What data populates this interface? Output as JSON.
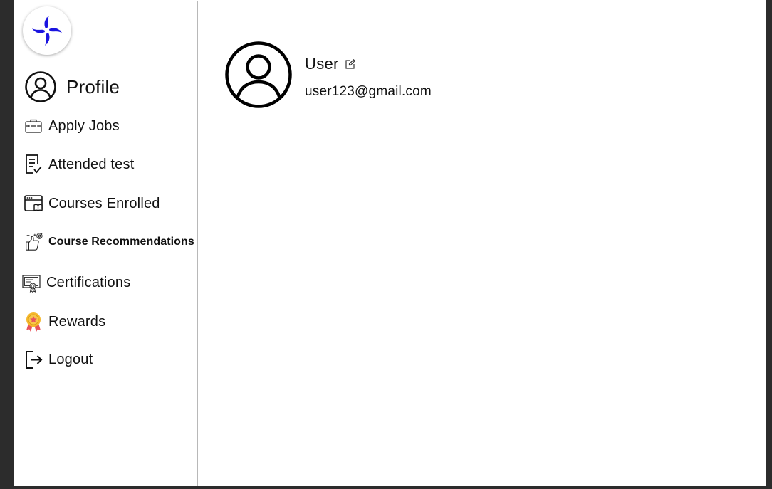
{
  "sidebar": {
    "logo_icon": "pinwheel-logo-icon",
    "profile": {
      "label": "Profile",
      "icon": "user-circle-icon"
    },
    "items": [
      {
        "label": "Apply Jobs",
        "icon": "briefcase-icon"
      },
      {
        "label": "Attended test",
        "icon": "checklist-document-icon"
      },
      {
        "label": "Courses Enrolled",
        "icon": "browser-book-icon"
      },
      {
        "label": "Course Recommendations",
        "icon": "thumbs-up-target-icon"
      },
      {
        "label": "Certifications",
        "icon": "certificate-icon"
      },
      {
        "label": "Rewards",
        "icon": "medal-icon"
      },
      {
        "label": "Logout",
        "icon": "logout-icon"
      }
    ]
  },
  "main": {
    "avatar_icon": "user-circle-icon",
    "user_name": "User",
    "edit_icon": "edit-pencil-icon",
    "email": "user123@gmail.com"
  },
  "colors": {
    "brand_blue": "#1a14e0",
    "background_outer": "#2c2c2c",
    "divider": "#b8b8b8",
    "medal_gold": "#f5b72a",
    "medal_ribbon": "#e8545c"
  }
}
